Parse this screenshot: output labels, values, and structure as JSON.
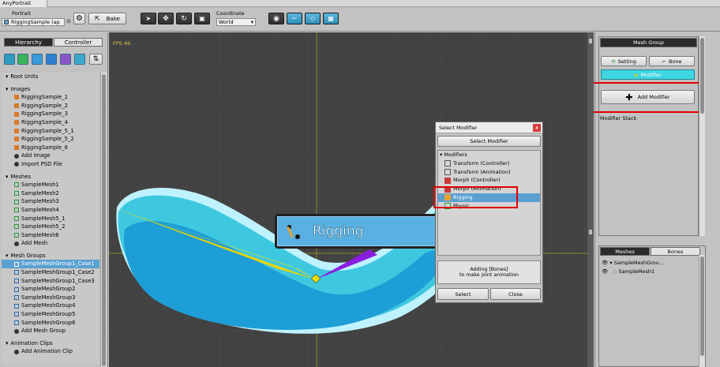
{
  "app": {
    "title": "AnyPortrait"
  },
  "toolbar": {
    "portrait_label": "Portrait",
    "portrait_value": "RiggingSample (ap",
    "bake_label": "Bake",
    "coordinate_label": "Coordinate",
    "coordinate_value": "World"
  },
  "left": {
    "tabs": [
      "Hierarchy",
      "Controller"
    ],
    "sections": [
      {
        "title": "Root Units",
        "items": []
      },
      {
        "title": "Images",
        "items": [
          "RiggingSample_1",
          "RiggingSample_2",
          "RiggingSample_3",
          "RiggingSample_4",
          "RiggingSample_5_1",
          "RiggingSample_5_2",
          "RiggingSample_6",
          "Add Image",
          "Import PSD File"
        ]
      },
      {
        "title": "Meshes",
        "items": [
          "SampleMesh1",
          "SampleMesh2",
          "SampleMesh3",
          "SampleMesh4",
          "SampleMesh5_1",
          "SampleMesh5_2",
          "SampleMesh6",
          "Add Mesh"
        ]
      },
      {
        "title": "Mesh Groups",
        "items": [
          "SampleMeshGroup1_Case1",
          "SampleMeshGroup1_Case2",
          "SampleMeshGroup1_Case3",
          "SampleMeshGroup2",
          "SampleMeshGroup3",
          "SampleMeshGroup4",
          "SampleMeshGroup5",
          "SampleMeshGroup6",
          "Add Mesh Group"
        ]
      },
      {
        "title": "Animation Clips",
        "items": [
          "Add Animation Clip"
        ]
      }
    ],
    "selected_item": "SampleMeshGroup1_Case1"
  },
  "viewport": {
    "fps": "FPS 46",
    "callout": "Rigging"
  },
  "dialog": {
    "title": "Select Modifier",
    "header": "Select Modifier",
    "category": "Modifiers",
    "items": [
      "Transform (Controller)",
      "Transform (Animation)",
      "Morph (Controller)",
      "Morph (Animation)",
      "Rigging",
      "Physic"
    ],
    "selected": "Rigging",
    "info_line1": "Adding [Bones]",
    "info_line2": "to make joint animation",
    "select_label": "Select",
    "close_label": "Close"
  },
  "right": {
    "title": "Mesh Group",
    "setting_label": "Setting",
    "bone_label": "Bone",
    "modifier_label": "Modifier",
    "add_modifier_label": "Add Modifier",
    "modifier_stack_label": "Modifier Stack",
    "tabs": [
      "Meshes",
      "Bones"
    ],
    "tree_group": "SampleMeshGrou...",
    "tree_mesh": "SampleMesh1"
  },
  "colors": {
    "accent": "#5aa0d2",
    "highlight": "#e00000",
    "modifier_button": "#3fd6e0"
  }
}
